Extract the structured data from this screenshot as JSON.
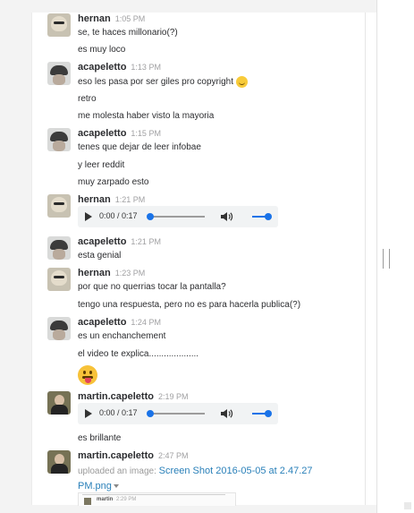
{
  "messages": [
    {
      "author": "hernan",
      "time": "1:05 PM",
      "lines": [
        "se, te haces millonario(?)",
        "es muy loco"
      ]
    },
    {
      "author": "acapeletto",
      "time": "1:13 PM",
      "lines": [
        "eso les pasa por ser giles pro copyright",
        "retro",
        "me molesta haber visto la mayoria"
      ]
    },
    {
      "author": "acapeletto",
      "time": "1:15 PM",
      "lines": [
        "tenes que dejar de leer infobae",
        "y leer reddit",
        "muy zarpado esto"
      ]
    },
    {
      "author": "hernan",
      "time": "1:21 PM",
      "audio": {
        "time": "0:00 / 0:17",
        "progress": 0.0,
        "volume": 1.0
      }
    },
    {
      "author": "acapeletto",
      "time": "1:21 PM",
      "lines": [
        "esta genial"
      ]
    },
    {
      "author": "hernan",
      "time": "1:23 PM",
      "lines": [
        "por que no querrias tocar la pantalla?",
        "tengo una respuesta, pero no es para hacerla publica(?)"
      ]
    },
    {
      "author": "acapeletto",
      "time": "1:24 PM",
      "lines": [
        "es un enchanchement",
        "el video te explica...................."
      ]
    },
    {
      "author": "martin.capeletto",
      "time": "2:19 PM",
      "audio": {
        "time": "0:00 / 0:17",
        "progress": 0.0,
        "volume": 1.0
      },
      "lines": [
        "es brillante"
      ]
    },
    {
      "author": "martin.capeletto",
      "time": "2:47 PM",
      "upload_prefix": "uploaded an image:",
      "upload_link": "Screen Shot 2016-05-05 at 2.47.27 PM.png",
      "thumb_author": "martin",
      "thumb_time": "2:29 PM"
    }
  ],
  "icons": {
    "smile": "slightly-smiling-face-icon",
    "tongue": "face-with-tongue-icon",
    "play": "play-icon",
    "volume": "speaker-icon",
    "caret": "caret-down-icon"
  },
  "colors": {
    "link": "#2a80b9",
    "audio_accent": "#1a73e8",
    "author": "#2c2d30",
    "timestamp": "#a0a0a2"
  }
}
